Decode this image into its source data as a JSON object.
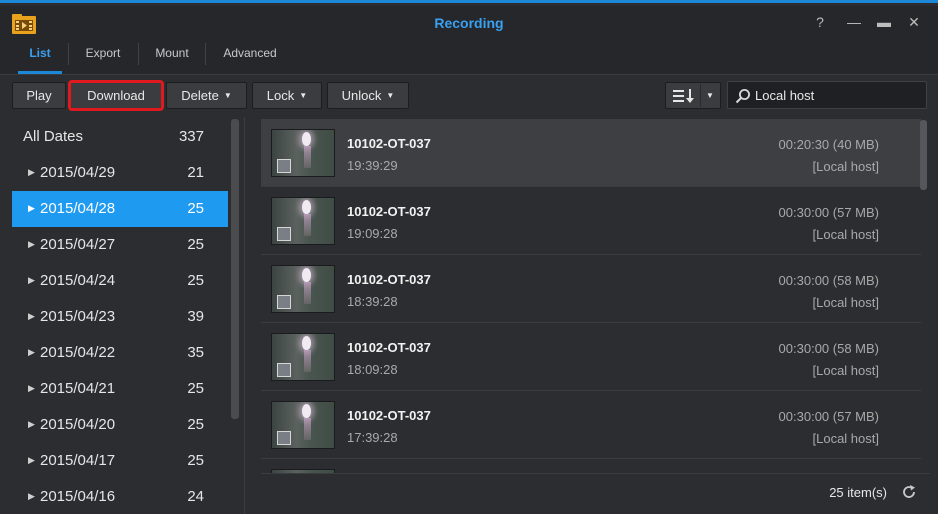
{
  "window": {
    "title": "Recording",
    "help_glyph": "?",
    "minimize_glyph": "—",
    "maximize_glyph": "▬",
    "close_glyph": "✕"
  },
  "tabs": [
    {
      "label": "List",
      "active": true
    },
    {
      "label": "Export",
      "active": false
    },
    {
      "label": "Mount",
      "active": false
    },
    {
      "label": "Advanced",
      "active": false
    }
  ],
  "toolbar": {
    "play_label": "Play",
    "download_label": "Download",
    "delete_label": "Delete",
    "lock_label": "Lock",
    "unlock_label": "Unlock",
    "sort_icon": "sort-icon",
    "search_value": "Local host"
  },
  "sidebar": {
    "all_label": "All Dates",
    "all_count": "337",
    "dates": [
      {
        "label": "2015/04/29",
        "count": "21"
      },
      {
        "label": "2015/04/28",
        "count": "25",
        "selected": true
      },
      {
        "label": "2015/04/27",
        "count": "25"
      },
      {
        "label": "2015/04/24",
        "count": "25"
      },
      {
        "label": "2015/04/23",
        "count": "39"
      },
      {
        "label": "2015/04/22",
        "count": "35"
      },
      {
        "label": "2015/04/21",
        "count": "25"
      },
      {
        "label": "2015/04/20",
        "count": "25"
      },
      {
        "label": "2015/04/17",
        "count": "25"
      },
      {
        "label": "2015/04/16",
        "count": "24"
      }
    ]
  },
  "recordings": [
    {
      "name": "10102-OT-037",
      "time": "19:39:29",
      "duration": "00:20:30 (40 MB)",
      "host": "[Local host]"
    },
    {
      "name": "10102-OT-037",
      "time": "19:09:28",
      "duration": "00:30:00 (57 MB)",
      "host": "[Local host]"
    },
    {
      "name": "10102-OT-037",
      "time": "18:39:28",
      "duration": "00:30:00 (58 MB)",
      "host": "[Local host]"
    },
    {
      "name": "10102-OT-037",
      "time": "18:09:28",
      "duration": "00:30:00 (58 MB)",
      "host": "[Local host]"
    },
    {
      "name": "10102-OT-037",
      "time": "17:39:28",
      "duration": "00:30:00 (57 MB)",
      "host": "[Local host]"
    }
  ],
  "footer": {
    "count_label": "25 item(s)"
  },
  "colors": {
    "accent": "#1e9af0",
    "title": "#3aa0f0",
    "highlight_box": "#e0191f"
  }
}
